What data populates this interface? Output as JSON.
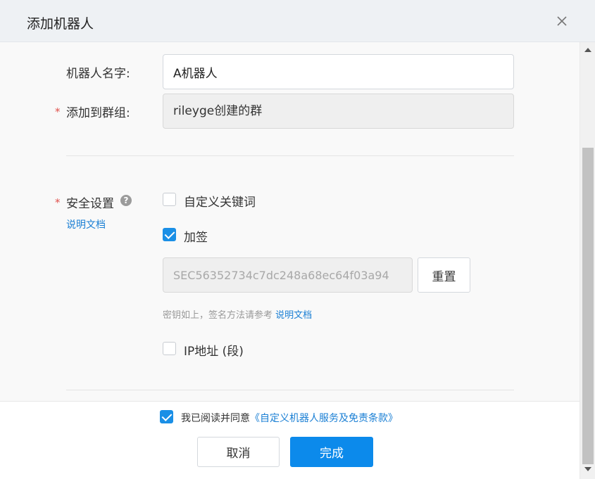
{
  "dialog": {
    "title": "添加机器人"
  },
  "form": {
    "robot_name": {
      "label": "机器人名字:",
      "value": "A机器人"
    },
    "group": {
      "label": "添加到群组:",
      "value": "rileyge创建的群"
    },
    "security": {
      "label": "安全设置",
      "doc_link": "说明文档",
      "options": {
        "keywords": {
          "label": "自定义关键词",
          "checked": false
        },
        "sign": {
          "label": "加签",
          "checked": true
        },
        "ip": {
          "label": "IP地址 (段)",
          "checked": false
        }
      },
      "secret_value": "SEC56352734c7dc248a68ec64f03a94",
      "reset_label": "重置",
      "hint_text": "密钥如上，签名方法请参考",
      "hint_link": "说明文档"
    }
  },
  "footer": {
    "agree_checked": true,
    "agree_text": "我已阅读并同意",
    "agree_link": "《自定义机器人服务及免责条款》",
    "cancel_label": "取消",
    "done_label": "完成"
  },
  "colors": {
    "accent": "#0c8aeb",
    "link": "#1a7fd4",
    "required": "#e0524d"
  }
}
